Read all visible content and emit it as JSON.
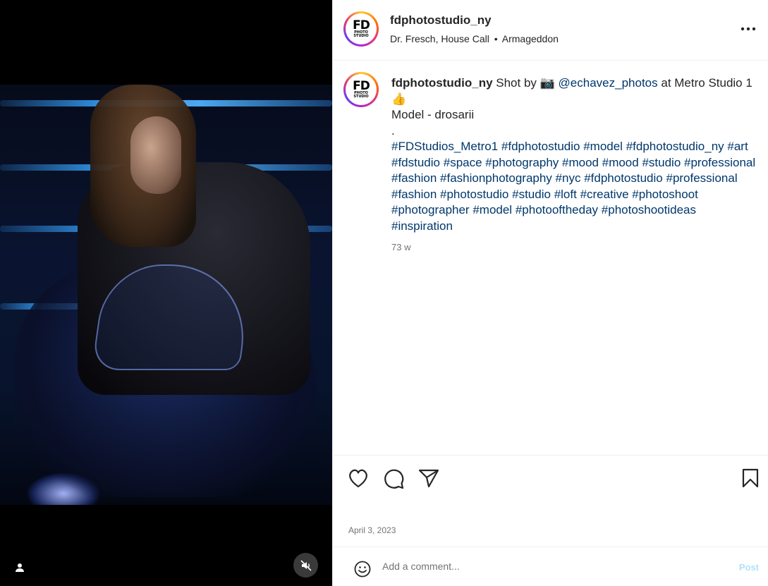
{
  "post": {
    "username": "fdphotostudio_ny",
    "audio": {
      "artist": "Dr. Fresch, House Call",
      "separator": "•",
      "track": "Armageddon"
    },
    "logo": {
      "main": "FD",
      "line1": "PHOTO",
      "line2": "STUDIO"
    }
  },
  "caption": {
    "username": "fdphotostudio_ny",
    "text_before_link": "Shot by 📷",
    "mention": "@echavez_photos",
    "text_after_link": "at Metro Studio 1👍",
    "model_line": "Model - drosarii",
    "dot_line": ".",
    "hashtags": [
      "#FDStudios_Metro1",
      "#fdphotostudio",
      "#model",
      "#fdphotostudio_ny",
      "#art",
      "#fdstudio",
      "#space",
      "#photography",
      "#mood",
      "#mood",
      "#studio",
      "#professional",
      "#fashion",
      "#fashionphotography",
      "#nyc",
      "#fdphotostudio",
      "#professional",
      "#fashion",
      "#photostudio",
      "#studio",
      "#loft",
      "#creative",
      "#photoshoot",
      "#photographer",
      "#model",
      "#photooftheday",
      "#photoshootideas",
      "#inspiration"
    ],
    "time_ago": "73 w"
  },
  "actions": {
    "like_icon": "heart-icon",
    "comment_icon": "comment-icon",
    "share_icon": "share-icon",
    "save_icon": "bookmark-icon",
    "date": "April 3, 2023"
  },
  "comment": {
    "placeholder": "Add a comment...",
    "post_label": "Post",
    "post_color": "#b2dffc"
  },
  "media": {
    "tag_icon": "user-tag-icon",
    "mute_icon": "muted-speaker-icon"
  }
}
